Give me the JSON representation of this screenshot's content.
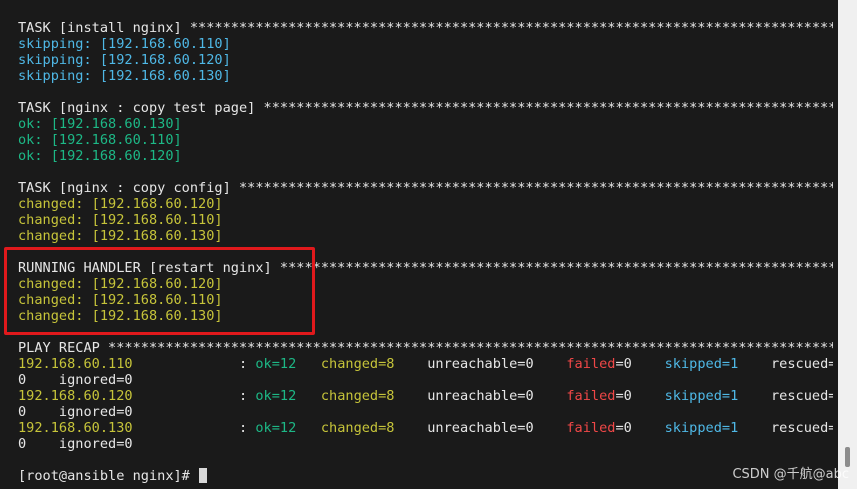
{
  "terminal": {
    "lines": [
      {
        "segments": [
          {
            "text": "TASK [install nginx] ***************************************************************************************",
            "color": "white"
          }
        ]
      },
      {
        "segments": [
          {
            "text": "skipping: [192.168.60.110]",
            "color": "cyan"
          }
        ]
      },
      {
        "segments": [
          {
            "text": "skipping: [192.168.60.120]",
            "color": "cyan"
          }
        ]
      },
      {
        "segments": [
          {
            "text": "skipping: [192.168.60.130]",
            "color": "cyan"
          }
        ]
      },
      {
        "segments": []
      },
      {
        "segments": [
          {
            "text": "TASK [nginx : copy test page] ***************************************************************************************",
            "color": "white"
          }
        ]
      },
      {
        "segments": [
          {
            "text": "ok: [192.168.60.130]",
            "color": "green"
          }
        ]
      },
      {
        "segments": [
          {
            "text": "ok: [192.168.60.110]",
            "color": "green"
          }
        ]
      },
      {
        "segments": [
          {
            "text": "ok: [192.168.60.120]",
            "color": "green"
          }
        ]
      },
      {
        "segments": []
      },
      {
        "segments": [
          {
            "text": "TASK [nginx : copy config] ***************************************************************************************",
            "color": "white"
          }
        ]
      },
      {
        "segments": [
          {
            "text": "changed: [192.168.60.120]",
            "color": "yellow"
          }
        ]
      },
      {
        "segments": [
          {
            "text": "changed: [192.168.60.110]",
            "color": "yellow"
          }
        ]
      },
      {
        "segments": [
          {
            "text": "changed: [192.168.60.130]",
            "color": "yellow"
          }
        ]
      },
      {
        "segments": []
      },
      {
        "segments": [
          {
            "text": "RUNNING HANDLER [restart nginx] ***************************************************************************************",
            "color": "white"
          }
        ]
      },
      {
        "segments": [
          {
            "text": "changed: [192.168.60.120]",
            "color": "yellow"
          }
        ]
      },
      {
        "segments": [
          {
            "text": "changed: [192.168.60.110]",
            "color": "yellow"
          }
        ]
      },
      {
        "segments": [
          {
            "text": "changed: [192.168.60.130]",
            "color": "yellow"
          }
        ]
      },
      {
        "segments": []
      },
      {
        "segments": [
          {
            "text": "PLAY RECAP ***************************************************************************************************************",
            "color": "white"
          }
        ]
      },
      {
        "segments": [
          {
            "text": "192.168.60.110",
            "color": "yellow"
          },
          {
            "text": "             : ",
            "color": "white"
          },
          {
            "text": "ok=12",
            "color": "green"
          },
          {
            "text": "   ",
            "color": "white"
          },
          {
            "text": "changed=8",
            "color": "yellow"
          },
          {
            "text": "    unreachable=0    ",
            "color": "white"
          },
          {
            "text": "failed",
            "color": "red"
          },
          {
            "text": "=0    ",
            "color": "white"
          },
          {
            "text": "skipped=1",
            "color": "cyan"
          },
          {
            "text": "    rescued=",
            "color": "white"
          }
        ]
      },
      {
        "segments": [
          {
            "text": "0    ignored=0",
            "color": "white"
          }
        ]
      },
      {
        "segments": [
          {
            "text": "192.168.60.120",
            "color": "yellow"
          },
          {
            "text": "             : ",
            "color": "white"
          },
          {
            "text": "ok=12",
            "color": "green"
          },
          {
            "text": "   ",
            "color": "white"
          },
          {
            "text": "changed=8",
            "color": "yellow"
          },
          {
            "text": "    unreachable=0    ",
            "color": "white"
          },
          {
            "text": "failed",
            "color": "red"
          },
          {
            "text": "=0    ",
            "color": "white"
          },
          {
            "text": "skipped=1",
            "color": "cyan"
          },
          {
            "text": "    rescued=",
            "color": "white"
          }
        ]
      },
      {
        "segments": [
          {
            "text": "0    ignored=0",
            "color": "white"
          }
        ]
      },
      {
        "segments": [
          {
            "text": "192.168.60.130",
            "color": "yellow"
          },
          {
            "text": "             : ",
            "color": "white"
          },
          {
            "text": "ok=12",
            "color": "green"
          },
          {
            "text": "   ",
            "color": "white"
          },
          {
            "text": "changed=8",
            "color": "yellow"
          },
          {
            "text": "    unreachable=0    ",
            "color": "white"
          },
          {
            "text": "failed",
            "color": "red"
          },
          {
            "text": "=0    ",
            "color": "white"
          },
          {
            "text": "skipped=1",
            "color": "cyan"
          },
          {
            "text": "    rescued=",
            "color": "white"
          }
        ]
      },
      {
        "segments": [
          {
            "text": "0    ignored=0",
            "color": "white"
          }
        ]
      },
      {
        "segments": []
      }
    ],
    "prompt": "[root@ansible nginx]# ",
    "highlight_color": "#e0191c",
    "colors": {
      "white": "#e6e6e6",
      "cyan": "#4fb8e6",
      "green": "#1db886",
      "yellow": "#c6c43a",
      "red": "#ef4747"
    }
  },
  "watermark": "CSDN @千航@abc"
}
